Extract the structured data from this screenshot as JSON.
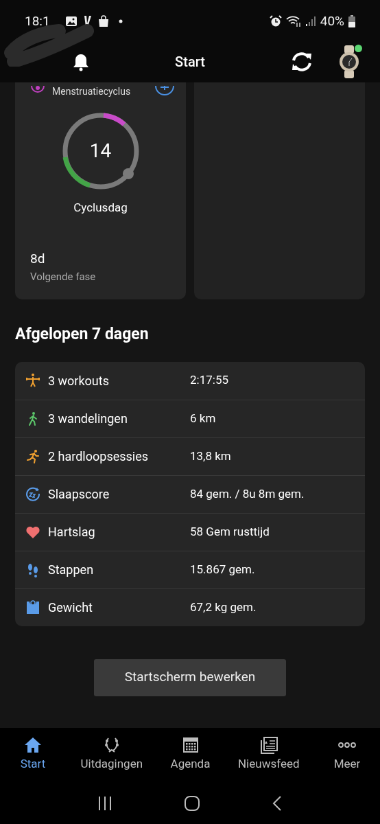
{
  "status_bar": {
    "time": "18:1",
    "battery": "40%"
  },
  "header": {
    "title": "Start",
    "watch_online": true
  },
  "cycle_card": {
    "title": "Menstruatiecyclus",
    "day": "14",
    "day_label": "Cyclusdag",
    "next_value": "8d",
    "next_label": "Volgende fase"
  },
  "summary": {
    "heading": "Afgelopen 7 dagen",
    "rows": [
      {
        "kind": "workout",
        "label": "3 workouts",
        "value": "2:17:55"
      },
      {
        "kind": "walk",
        "label": "3 wandelingen",
        "value": "6 km"
      },
      {
        "kind": "run",
        "label": "2 hardloopsessies",
        "value": "13,8 km"
      },
      {
        "kind": "sleep",
        "label": "Slaapscore",
        "value": "84 gem. / 8u 8m gem."
      },
      {
        "kind": "heart",
        "label": "Hartslag",
        "value": "58 Gem rusttijd"
      },
      {
        "kind": "steps",
        "label": "Stappen",
        "value": "15.867 gem."
      },
      {
        "kind": "weight",
        "label": "Gewicht",
        "value": "67,2 kg gem."
      }
    ]
  },
  "edit_button": "Startscherm bewerken",
  "bottom_nav": [
    {
      "kind": "home",
      "label": "Start",
      "selected": true
    },
    {
      "kind": "challenges",
      "label": "Uitdagingen",
      "selected": false
    },
    {
      "kind": "calendar",
      "label": "Agenda",
      "selected": false
    },
    {
      "kind": "news",
      "label": "Nieuwsfeed",
      "selected": false
    },
    {
      "kind": "more",
      "label": "Meer",
      "selected": false
    }
  ]
}
